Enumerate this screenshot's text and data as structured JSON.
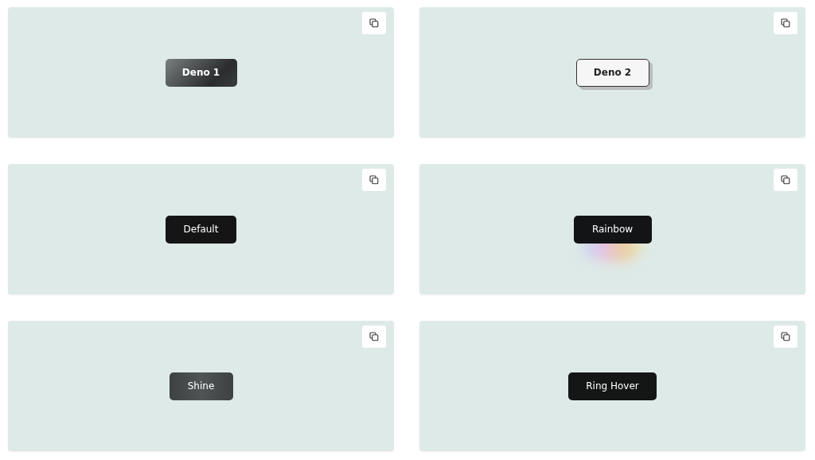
{
  "cards": [
    {
      "kind": "deno1",
      "label": "Deno 1"
    },
    {
      "kind": "deno2",
      "label": "Deno 2"
    },
    {
      "kind": "default",
      "label": "Default"
    },
    {
      "kind": "rainbow",
      "label": "Rainbow"
    },
    {
      "kind": "shine",
      "label": "Shine"
    },
    {
      "kind": "ring",
      "label": "Ring Hover"
    }
  ]
}
